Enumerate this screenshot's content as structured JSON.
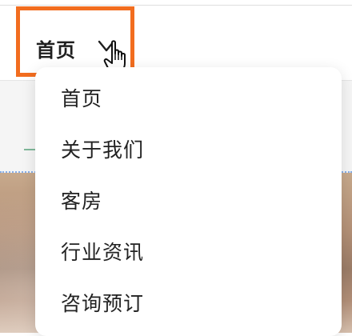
{
  "nav": {
    "current_label": "首页",
    "chevron_icon": "chevron-down-icon",
    "cursor_icon": "hand-pointer-icon",
    "highlight_color": "#f26d1f"
  },
  "dropdown": {
    "items": [
      {
        "label": "首页"
      },
      {
        "label": "关于我们"
      },
      {
        "label": "客房"
      },
      {
        "label": "行业资讯"
      },
      {
        "label": "咨询预订"
      }
    ]
  }
}
